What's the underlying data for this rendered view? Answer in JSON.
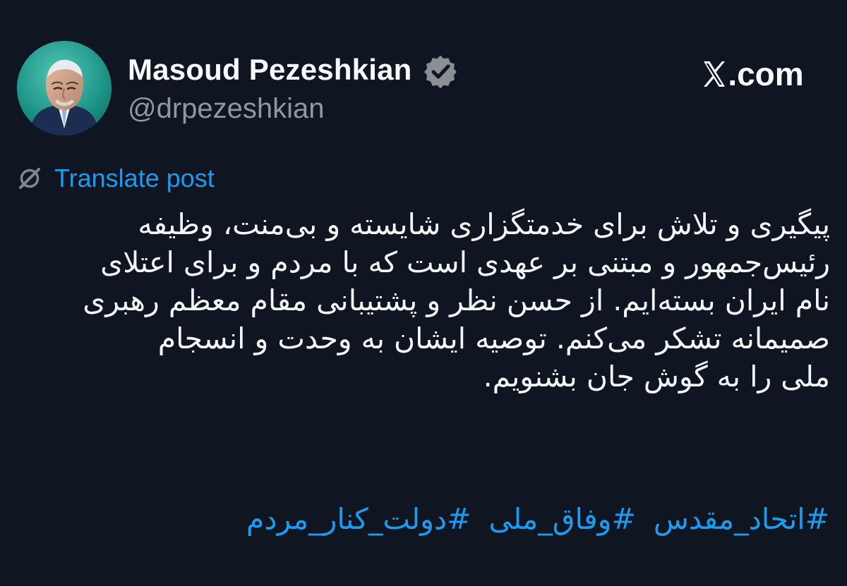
{
  "post": {
    "author": {
      "display_name": "Masoud Pezeshkian",
      "handle": "@drpezeshkian",
      "verified_icon": "verified-badge-icon",
      "avatar_icon": "profile-photo"
    },
    "brand": {
      "icon": "x-logo-icon",
      "label": ".com"
    },
    "translate": {
      "label": "Translate post",
      "icon": "translate-icon"
    },
    "text_lines": [
      "پیگیری و تلاش برای خدمتگزاری شایسته و بی‌منت، وظیفه",
      "رئیس‌جمهور و مبتنی بر عهدی است که با مردم و برای اعتلای",
      "نام ایران بسته‌ایم. از حسن نظر و پشتیبانی مقام معظم رهبری",
      "صمیمانه تشکر می‌کنم. توصیه ایشان به وحدت و انسجام",
      "ملی را به گوش جان بشنویم."
    ],
    "hashtags": [
      "#اتحاد_مقدس",
      "#وفاق_ملی",
      "#دولت_کنار_مردم"
    ],
    "colors": {
      "background": "#0f1621",
      "primary_text": "#f3f5f7",
      "secondary_text": "#8e97a2",
      "link": "#1d9bf0",
      "verified_badge": "#8a8f96"
    }
  }
}
